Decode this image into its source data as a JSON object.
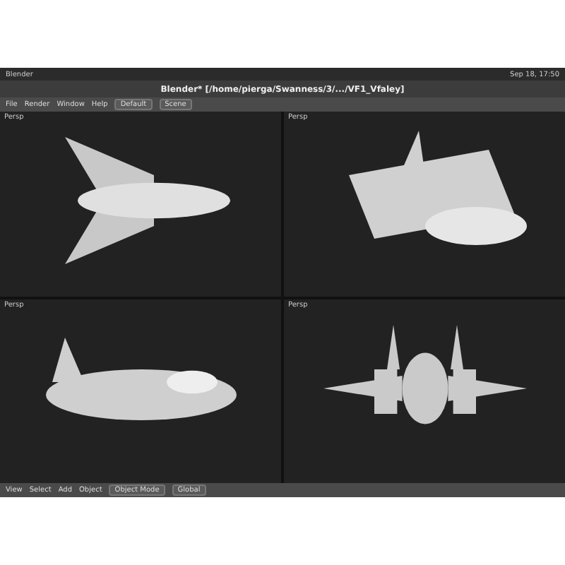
{
  "topbar": {
    "app": "Blender",
    "clock": "Sep 18, 17:50"
  },
  "window": {
    "title": "Blender* [/home/pierga/Swanness/3/.../VF1_Vfaley]"
  },
  "menu": {
    "items": [
      "File",
      "Render",
      "Window",
      "Help"
    ],
    "layout": "Default",
    "scene": "Scene"
  },
  "viewports": [
    {
      "header": "Persp",
      "kind": "top"
    },
    {
      "header": "Persp",
      "kind": "angle"
    },
    {
      "header": "Persp",
      "kind": "side"
    },
    {
      "header": "Persp",
      "kind": "front"
    }
  ],
  "toolbar": {
    "items": [
      "View",
      "Select",
      "Add",
      "Object"
    ],
    "mode": "Object Mode",
    "orientation": "Global"
  }
}
